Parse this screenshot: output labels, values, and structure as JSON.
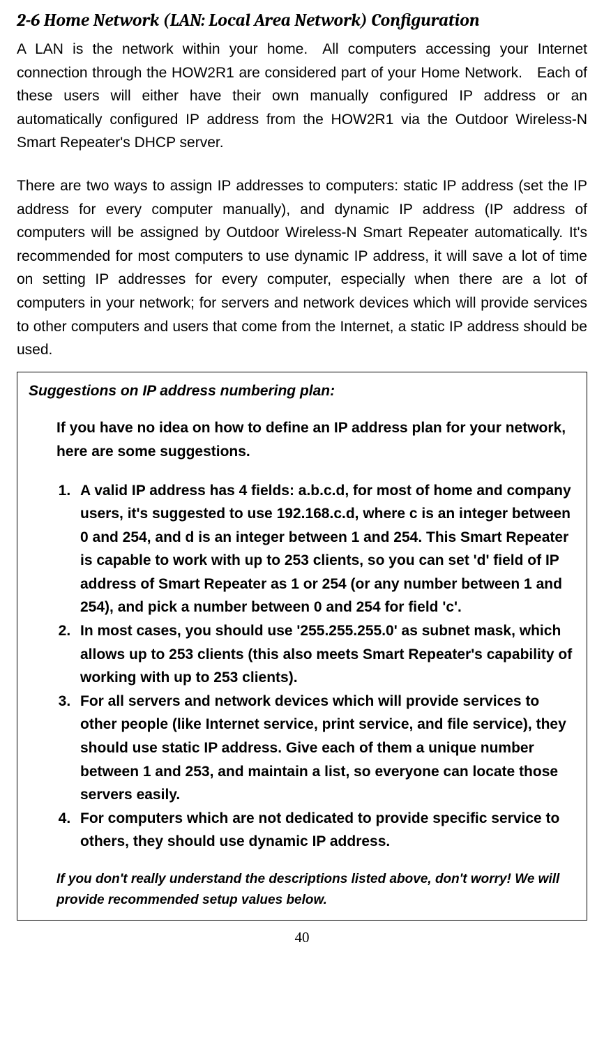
{
  "heading": "2-6 Home Network (LAN: Local Area Network) Configuration",
  "para1": "A LAN is the network within your home. All computers accessing your Internet connection through the HOW2R1 are considered part of your Home Network. Each of these users will either have their own manually configured IP address or an automatically configured IP address from the HOW2R1 via the Outdoor Wireless-N Smart Repeater's DHCP server.",
  "para2": "There are two ways to assign IP addresses to computers: static IP address (set the IP address for every computer manually), and dynamic IP address (IP address of computers will be assigned by Outdoor Wireless-N Smart Repeater automatically. It's recommended for most computers to use dynamic IP address, it will save a lot of time on setting IP addresses for every computer, especially when there are a lot of computers in your network; for servers and network devices which will provide services to other computers and users that come from the Internet, a static IP address should be used.",
  "box": {
    "title": "Suggestions on IP address numbering plan:",
    "intro": "If you have no idea on how to define an IP address plan for your network, here are some suggestions.",
    "items": [
      "A valid IP address has 4 fields: a.b.c.d, for most of home and company users, it's suggested to use 192.168.c.d, where c is an integer between 0 and 254, and d is an integer between 1 and 254. This Smart Repeater is capable to work with up to 253 clients, so you can set 'd' field of IP address of Smart Repeater as 1 or 254 (or any number between 1 and 254), and pick a number between 0 and 254 for field 'c'.",
      "In most cases, you should use '255.255.255.0' as subnet mask, which allows up to 253 clients (this also meets Smart Repeater's capability of working with up to 253 clients).",
      "For all servers and network devices which will provide services to other people (like Internet service, print service, and file service), they should use static IP address. Give each of them a unique number between 1 and 253, and maintain a list, so everyone can locate those servers easily.",
      "For computers which are not dedicated to provide specific service to others, they should use dynamic IP address."
    ],
    "footer": "If you don't really understand the descriptions listed above, don't worry! We will provide recommended setup values below."
  },
  "page_number": "40"
}
